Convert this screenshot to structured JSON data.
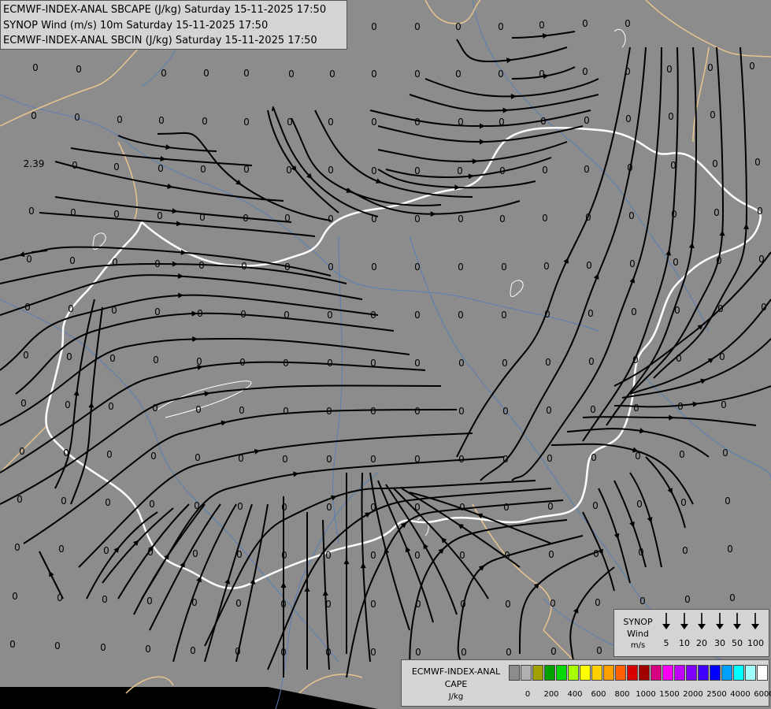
{
  "titles": {
    "line1": "ECMWF-INDEX-ANAL SBCAPE (J/kg) Saturday 15-11-2025 17:50",
    "line2": "SYNOP Wind (m/s) 10m Saturday 15-11-2025 17:50",
    "line3": "ECMWF-INDEX-ANAL SBCIN (J/kg) Saturday 15-11-2025 17:50"
  },
  "colors": {
    "background": "#8c8c8c",
    "border": "#ffffff",
    "region_line": "#e8c48e",
    "river": "#5a7fb3",
    "streamline": "#000000",
    "label": "#000000"
  },
  "wind_legend": {
    "title": "SYNOP\nWind",
    "unit": "m/s",
    "items": [
      "5",
      "10",
      "20",
      "30",
      "50",
      "100"
    ]
  },
  "cape_legend": {
    "title": "ECMWF-INDEX-ANAL\nCAPE",
    "unit": "J/kg",
    "colors": [
      "#8c8c8c",
      "#b0b0b0",
      "#a0a000",
      "#00a000",
      "#00d800",
      "#a8ff00",
      "#ffff00",
      "#ffd000",
      "#ffa000",
      "#ff6000",
      "#d80000",
      "#a00000",
      "#d80080",
      "#ff00ff",
      "#c000ff",
      "#8000ff",
      "#4000ff",
      "#0000ff",
      "#00a0ff",
      "#00ffff",
      "#a0ffff",
      "#ffffff"
    ],
    "labels": [
      "0",
      "200",
      "400",
      "600",
      "800",
      "1000",
      "1500",
      "2000",
      "2500",
      "4000",
      "6000"
    ]
  },
  "map": {
    "cin_labels": [
      [
        45,
        90,
        "0"
      ],
      [
        100,
        92,
        "0"
      ],
      [
        208,
        97,
        "0"
      ],
      [
        262,
        97,
        "0"
      ],
      [
        313,
        97,
        "0"
      ],
      [
        370,
        98,
        "0"
      ],
      [
        422,
        98,
        "0"
      ],
      [
        475,
        98,
        "0"
      ],
      [
        530,
        98,
        "0"
      ],
      [
        582,
        98,
        "0"
      ],
      [
        636,
        98,
        "0"
      ],
      [
        688,
        98,
        "0"
      ],
      [
        743,
        95,
        "0"
      ],
      [
        797,
        95,
        "0"
      ],
      [
        850,
        92,
        "0"
      ],
      [
        902,
        90,
        "0"
      ],
      [
        955,
        88,
        "0"
      ],
      [
        43,
        151,
        "0"
      ],
      [
        98,
        153,
        "0"
      ],
      [
        152,
        156,
        "0"
      ],
      [
        205,
        157,
        "0"
      ],
      [
        260,
        158,
        "0"
      ],
      [
        313,
        159,
        "0"
      ],
      [
        368,
        159,
        "0"
      ],
      [
        420,
        159,
        "0"
      ],
      [
        475,
        159,
        "0"
      ],
      [
        530,
        159,
        "0"
      ],
      [
        585,
        159,
        "0"
      ],
      [
        637,
        159,
        "0"
      ],
      [
        690,
        158,
        "0"
      ],
      [
        745,
        157,
        "0"
      ],
      [
        798,
        155,
        "0"
      ],
      [
        852,
        152,
        "0"
      ],
      [
        905,
        150,
        "0"
      ],
      [
        43,
        212,
        "2.39"
      ],
      [
        95,
        214,
        "0"
      ],
      [
        148,
        216,
        "0"
      ],
      [
        204,
        218,
        "0"
      ],
      [
        258,
        219,
        "0"
      ],
      [
        313,
        219,
        "0"
      ],
      [
        367,
        220,
        "0"
      ],
      [
        420,
        220,
        "0"
      ],
      [
        475,
        221,
        "0"
      ],
      [
        530,
        221,
        "0"
      ],
      [
        584,
        221,
        "0"
      ],
      [
        638,
        221,
        "0"
      ],
      [
        692,
        220,
        "0"
      ],
      [
        745,
        219,
        "0"
      ],
      [
        800,
        217,
        "0"
      ],
      [
        855,
        214,
        "0"
      ],
      [
        908,
        212,
        "0"
      ],
      [
        962,
        210,
        "0"
      ],
      [
        40,
        272,
        "0"
      ],
      [
        93,
        274,
        "0"
      ],
      [
        148,
        276,
        "0"
      ],
      [
        203,
        278,
        "0"
      ],
      [
        257,
        280,
        "0"
      ],
      [
        312,
        281,
        "0"
      ],
      [
        365,
        281,
        "0"
      ],
      [
        420,
        282,
        "0"
      ],
      [
        475,
        282,
        "0"
      ],
      [
        530,
        282,
        "0"
      ],
      [
        585,
        282,
        "0"
      ],
      [
        638,
        282,
        "0"
      ],
      [
        692,
        281,
        "0"
      ],
      [
        747,
        280,
        "0"
      ],
      [
        802,
        278,
        "0"
      ],
      [
        856,
        276,
        "0"
      ],
      [
        910,
        274,
        "0"
      ],
      [
        965,
        272,
        "0"
      ],
      [
        37,
        333,
        "0"
      ],
      [
        92,
        335,
        "0"
      ],
      [
        146,
        337,
        "0"
      ],
      [
        200,
        339,
        "0"
      ],
      [
        256,
        341,
        "0"
      ],
      [
        310,
        342,
        "0"
      ],
      [
        365,
        343,
        "0"
      ],
      [
        420,
        343,
        "0"
      ],
      [
        475,
        343,
        "0"
      ],
      [
        530,
        343,
        "0"
      ],
      [
        585,
        343,
        "0"
      ],
      [
        640,
        343,
        "0"
      ],
      [
        694,
        342,
        "0"
      ],
      [
        748,
        341,
        "0"
      ],
      [
        803,
        339,
        "0"
      ],
      [
        858,
        337,
        "0"
      ],
      [
        913,
        335,
        "0"
      ],
      [
        967,
        333,
        "0"
      ],
      [
        35,
        394,
        "0"
      ],
      [
        90,
        396,
        "0"
      ],
      [
        145,
        398,
        "0"
      ],
      [
        200,
        400,
        "0"
      ],
      [
        254,
        402,
        "0"
      ],
      [
        309,
        403,
        "0"
      ],
      [
        364,
        404,
        "0"
      ],
      [
        419,
        404,
        "0"
      ],
      [
        474,
        404,
        "0"
      ],
      [
        530,
        404,
        "0"
      ],
      [
        585,
        404,
        "0"
      ],
      [
        640,
        404,
        "0"
      ],
      [
        695,
        403,
        "0"
      ],
      [
        750,
        402,
        "0"
      ],
      [
        805,
        400,
        "0"
      ],
      [
        860,
        398,
        "0"
      ],
      [
        915,
        396,
        "0"
      ],
      [
        970,
        394,
        "0"
      ],
      [
        33,
        455,
        "0"
      ],
      [
        88,
        457,
        "0"
      ],
      [
        143,
        459,
        "0"
      ],
      [
        198,
        461,
        "0"
      ],
      [
        253,
        463,
        "0"
      ],
      [
        308,
        464,
        "0"
      ],
      [
        363,
        465,
        "0"
      ],
      [
        419,
        465,
        "0"
      ],
      [
        474,
        465,
        "0"
      ],
      [
        530,
        465,
        "0"
      ],
      [
        586,
        465,
        "0"
      ],
      [
        641,
        465,
        "0"
      ],
      [
        696,
        464,
        "0"
      ],
      [
        751,
        463,
        "0"
      ],
      [
        807,
        461,
        "0"
      ],
      [
        862,
        459,
        "0"
      ],
      [
        917,
        457,
        "0"
      ],
      [
        30,
        516,
        "0"
      ],
      [
        86,
        518,
        "0"
      ],
      [
        141,
        520,
        "0"
      ],
      [
        197,
        522,
        "0"
      ],
      [
        252,
        524,
        "0"
      ],
      [
        307,
        525,
        "0"
      ],
      [
        363,
        526,
        "0"
      ],
      [
        418,
        526,
        "0"
      ],
      [
        474,
        526,
        "0"
      ],
      [
        530,
        526,
        "0"
      ],
      [
        586,
        526,
        "0"
      ],
      [
        642,
        526,
        "0"
      ],
      [
        697,
        525,
        "0"
      ],
      [
        753,
        524,
        "0"
      ],
      [
        808,
        522,
        "0"
      ],
      [
        864,
        520,
        "0"
      ],
      [
        919,
        518,
        "0"
      ],
      [
        28,
        577,
        "0"
      ],
      [
        84,
        579,
        "0"
      ],
      [
        139,
        581,
        "0"
      ],
      [
        195,
        583,
        "0"
      ],
      [
        251,
        585,
        "0"
      ],
      [
        306,
        586,
        "0"
      ],
      [
        362,
        587,
        "0"
      ],
      [
        418,
        587,
        "0"
      ],
      [
        474,
        587,
        "0"
      ],
      [
        530,
        587,
        "0"
      ],
      [
        586,
        587,
        "0"
      ],
      [
        642,
        587,
        "0"
      ],
      [
        698,
        586,
        "0"
      ],
      [
        754,
        585,
        "0"
      ],
      [
        810,
        583,
        "0"
      ],
      [
        866,
        581,
        "0"
      ],
      [
        921,
        579,
        "0"
      ],
      [
        25,
        638,
        "0"
      ],
      [
        81,
        640,
        "0"
      ],
      [
        137,
        642,
        "0"
      ],
      [
        193,
        644,
        "0"
      ],
      [
        250,
        646,
        "0"
      ],
      [
        305,
        647,
        "0"
      ],
      [
        361,
        648,
        "0"
      ],
      [
        418,
        648,
        "0"
      ],
      [
        474,
        648,
        "0"
      ],
      [
        530,
        648,
        "0"
      ],
      [
        587,
        648,
        "0"
      ],
      [
        643,
        648,
        "0"
      ],
      [
        699,
        647,
        "0"
      ],
      [
        756,
        646,
        "0"
      ],
      [
        812,
        644,
        "0"
      ],
      [
        868,
        642,
        "0"
      ],
      [
        924,
        640,
        "0"
      ],
      [
        22,
        699,
        "0"
      ],
      [
        78,
        701,
        "0"
      ],
      [
        135,
        703,
        "0"
      ],
      [
        191,
        705,
        "0"
      ],
      [
        248,
        707,
        "0"
      ],
      [
        304,
        708,
        "0"
      ],
      [
        361,
        709,
        "0"
      ],
      [
        417,
        709,
        "0"
      ],
      [
        474,
        709,
        "0"
      ],
      [
        530,
        709,
        "0"
      ],
      [
        587,
        709,
        "0"
      ],
      [
        644,
        709,
        "0"
      ],
      [
        700,
        708,
        "0"
      ],
      [
        757,
        707,
        "0"
      ],
      [
        814,
        705,
        "0"
      ],
      [
        870,
        703,
        "0"
      ],
      [
        927,
        701,
        "0"
      ],
      [
        19,
        761,
        "0"
      ],
      [
        76,
        763,
        "0"
      ],
      [
        133,
        765,
        "0"
      ],
      [
        190,
        767,
        "0"
      ],
      [
        247,
        769,
        "0"
      ],
      [
        303,
        770,
        "0"
      ],
      [
        360,
        771,
        "0"
      ],
      [
        417,
        771,
        "0"
      ],
      [
        474,
        771,
        "0"
      ],
      [
        531,
        771,
        "0"
      ],
      [
        588,
        771,
        "0"
      ],
      [
        645,
        771,
        "0"
      ],
      [
        702,
        770,
        "0"
      ],
      [
        759,
        769,
        "0"
      ],
      [
        816,
        767,
        "0"
      ],
      [
        873,
        765,
        "0"
      ],
      [
        930,
        763,
        "0"
      ],
      [
        16,
        822,
        "0"
      ],
      [
        73,
        824,
        "0"
      ],
      [
        131,
        826,
        "0"
      ],
      [
        188,
        828,
        "0"
      ],
      [
        245,
        830,
        "0"
      ],
      [
        302,
        831,
        "0"
      ],
      [
        360,
        832,
        "0"
      ],
      [
        417,
        832,
        "0"
      ],
      [
        474,
        832,
        "0"
      ],
      [
        531,
        832,
        "0"
      ],
      [
        589,
        832,
        "0"
      ],
      [
        646,
        832,
        "0"
      ],
      [
        703,
        831,
        "0"
      ],
      [
        761,
        830,
        "0"
      ],
      [
        818,
        828,
        "0"
      ],
      [
        876,
        826,
        "0"
      ],
      [
        933,
        824,
        "0"
      ],
      [
        420,
        38,
        "0"
      ],
      [
        475,
        38,
        "0"
      ],
      [
        530,
        38,
        "0"
      ],
      [
        582,
        38,
        "0"
      ],
      [
        636,
        38,
        "0"
      ],
      [
        688,
        36,
        "0"
      ],
      [
        743,
        34,
        "0"
      ],
      [
        797,
        34,
        "0"
      ]
    ]
  }
}
